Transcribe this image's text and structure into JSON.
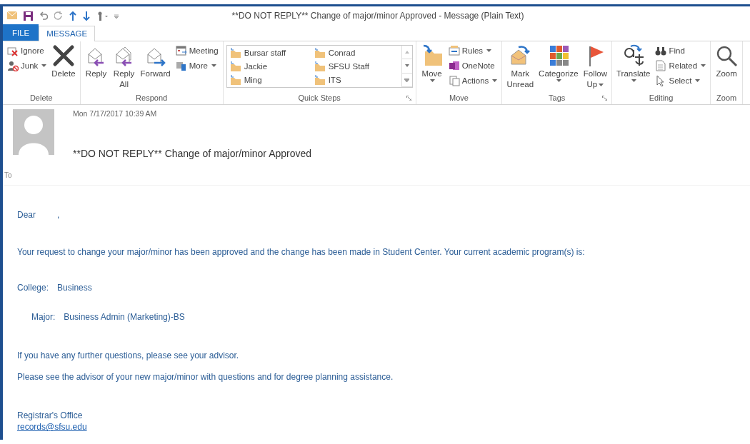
{
  "window": {
    "title": "**DO NOT REPLY**  Change of major/minor Approved - Message (Plain Text)"
  },
  "tabs": [
    {
      "label": "FILE",
      "kind": "file",
      "selected": false
    },
    {
      "label": "MESSAGE",
      "kind": "tab",
      "selected": true
    }
  ],
  "ribbon": {
    "groups": [
      {
        "label": "Delete",
        "kind": "buttons",
        "launcher": false,
        "items": [
          {
            "kind": "small",
            "label": "Ignore",
            "has_menu": false
          },
          {
            "kind": "small",
            "label": "Junk",
            "has_menu": true
          },
          {
            "kind": "large",
            "label": "Delete",
            "has_menu": false
          }
        ]
      },
      {
        "label": "Respond",
        "kind": "buttons",
        "launcher": false,
        "items": [
          {
            "kind": "large",
            "label": "Reply",
            "has_menu": false
          },
          {
            "kind": "large",
            "label": "Reply\nAll",
            "has_menu": false
          },
          {
            "kind": "large",
            "label": "Forward",
            "has_menu": false
          },
          {
            "kind": "small",
            "label": "Meeting",
            "has_menu": false
          },
          {
            "kind": "small",
            "label": "More",
            "has_menu": true
          }
        ]
      },
      {
        "label": "Quick Steps",
        "kind": "gallery",
        "launcher": true,
        "items": [
          {
            "label": "Bursar staff"
          },
          {
            "label": "Conrad"
          },
          {
            "label": "Jackie"
          },
          {
            "label": "SFSU Staff"
          },
          {
            "label": "Ming"
          },
          {
            "label": "ITS"
          }
        ]
      },
      {
        "label": "Move",
        "kind": "buttons",
        "launcher": false,
        "items": [
          {
            "kind": "large",
            "label": "Move",
            "has_menu": true
          },
          {
            "kind": "small",
            "label": "Rules",
            "has_menu": true
          },
          {
            "kind": "small",
            "label": "OneNote",
            "has_menu": false
          },
          {
            "kind": "small",
            "label": "Actions",
            "has_menu": true
          }
        ]
      },
      {
        "label": "Tags",
        "kind": "buttons",
        "launcher": true,
        "items": [
          {
            "kind": "large",
            "label": "Mark\nUnread",
            "has_menu": false
          },
          {
            "kind": "large",
            "label": "Categorize",
            "has_menu": true
          },
          {
            "kind": "large",
            "label": "Follow\nUp",
            "has_menu": true
          }
        ]
      },
      {
        "label": "Editing",
        "kind": "buttons",
        "launcher": false,
        "items": [
          {
            "kind": "large",
            "label": "Translate",
            "has_menu": true
          },
          {
            "kind": "small",
            "label": "Find",
            "has_menu": false
          },
          {
            "kind": "small",
            "label": "Related",
            "has_menu": true
          },
          {
            "kind": "small",
            "label": "Select",
            "has_menu": true
          }
        ]
      },
      {
        "label": "Zoom",
        "kind": "buttons",
        "launcher": false,
        "items": [
          {
            "kind": "large",
            "label": "Zoom",
            "has_menu": false
          }
        ]
      }
    ]
  },
  "header": {
    "date": "Mon 7/17/2017 10:39 AM",
    "subject": "**DO NOT REPLY**  Change of major/minor Approved",
    "to_label": "To"
  },
  "body": [
    {
      "kind": "greeting",
      "texts": [
        "Dear",
        ","
      ]
    },
    {
      "kind": "paragraph",
      "text": "Your request to change your major/minor has been approved and the change has been made in Student Center.  Your current academic program(s) is:"
    },
    {
      "kind": "field",
      "label": "College:",
      "value": "Business",
      "children": [
        {
          "label": "Major:",
          "value": "Business Admin (Marketing)-BS"
        }
      ]
    },
    {
      "kind": "paragraph",
      "text": "If you have any further questions, please see your advisor."
    },
    {
      "kind": "paragraph",
      "text": "Please see the advisor of your new major/minor with questions and for degree planning assistance."
    },
    {
      "kind": "signature",
      "text": "Registrar's Office"
    },
    {
      "kind": "link",
      "text": "records@sfsu.edu"
    }
  ]
}
